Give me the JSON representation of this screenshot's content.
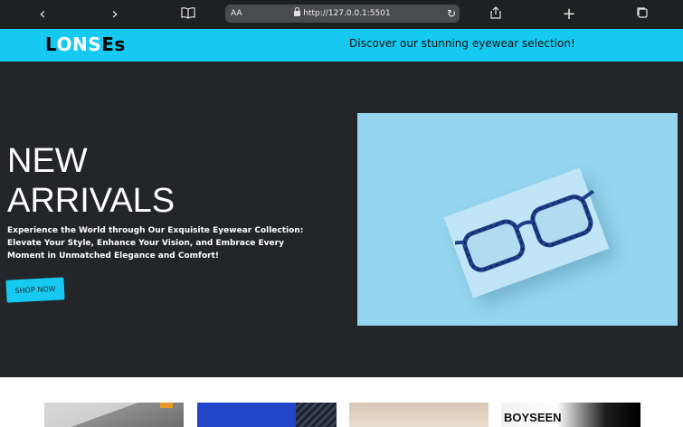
{
  "browser": {
    "url": "http://127.0.0.1:5501",
    "text_size_label": "AA"
  },
  "header": {
    "logo": {
      "part1": "L",
      "part2": "O",
      "part3": "NS",
      "part4": "Es"
    },
    "tagline": "Discover our stunning eyewear selection!"
  },
  "hero": {
    "title_line1": "NEW",
    "title_line2": "ARRIVALS",
    "description": "Experience the World through Our Exquisite Eyewear Collection: Elevate Your Style, Enhance Your Vision, and Embrace Every Moment in Unmatched Elegance and Comfort!",
    "cta_label": "SHOP NOW"
  },
  "products": {
    "card4_label": "BOYSEEN"
  },
  "colors": {
    "accent": "#16c9f0",
    "hero_bg": "#232529",
    "hero_image_bg": "#95d5ef"
  },
  "icons": [
    "chevron-left-icon",
    "chevron-right-icon",
    "book-icon",
    "lock-icon",
    "reload-icon",
    "share-icon",
    "plus-icon",
    "tabs-icon"
  ]
}
